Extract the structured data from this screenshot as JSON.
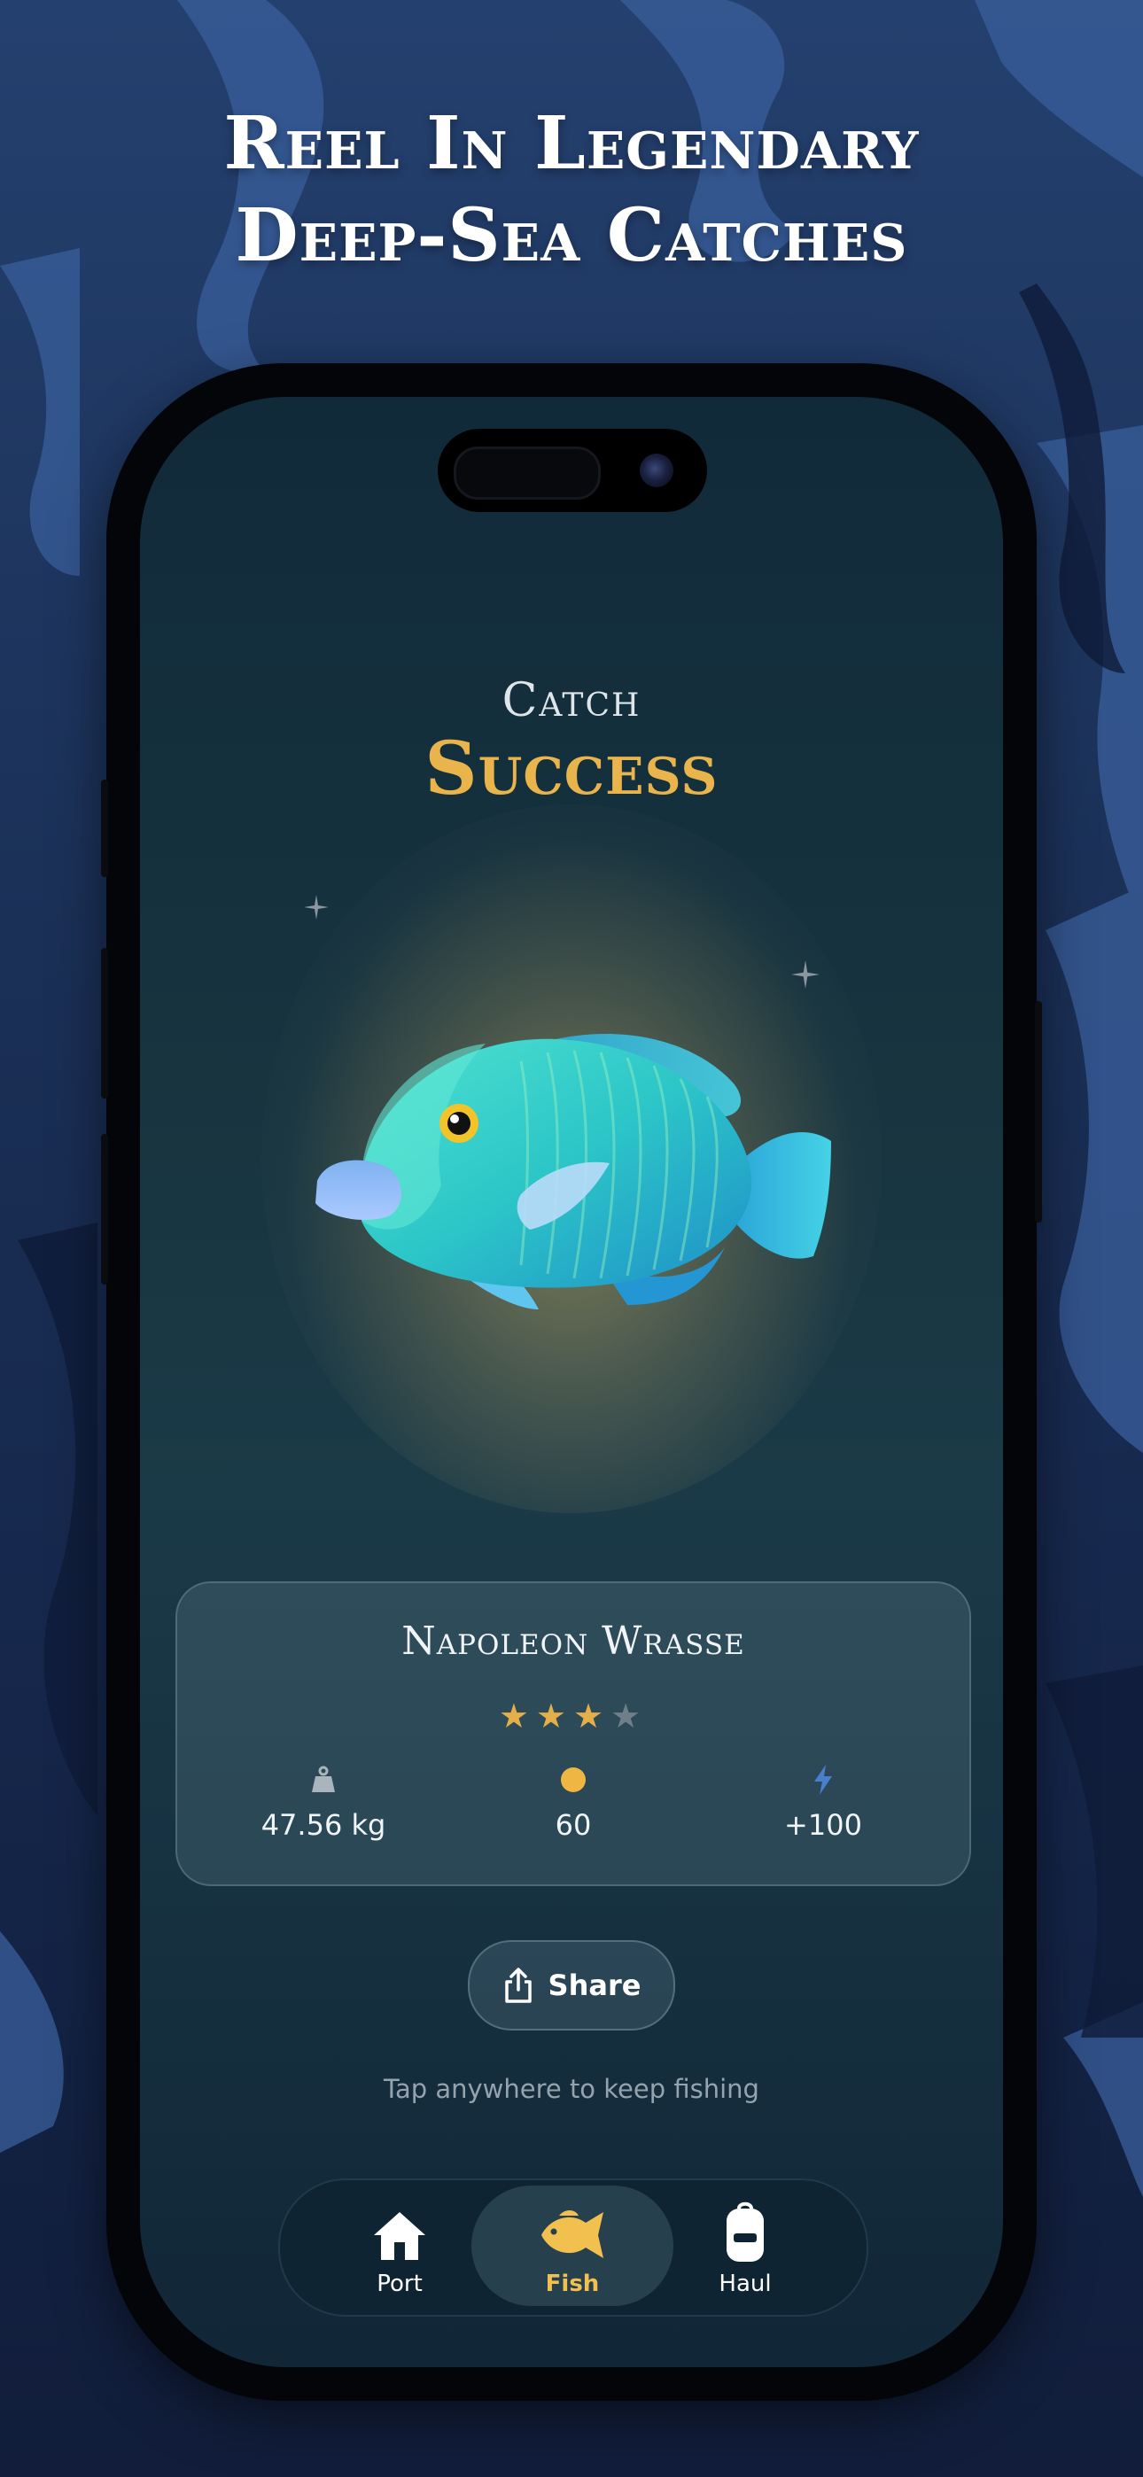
{
  "headline": {
    "line1": "Reel In Legendary",
    "line2": "Deep-Sea Catches"
  },
  "screen": {
    "title_small": "Catch",
    "title_big": "Success"
  },
  "catch_card": {
    "fish_name": "Napoleon Wrasse",
    "rating": 3,
    "rating_max": 5,
    "stats": [
      {
        "icon": "weight-icon",
        "value": "47.56 kg"
      },
      {
        "icon": "coin-icon",
        "value": "60"
      },
      {
        "icon": "lightning-icon",
        "value": "+100"
      }
    ]
  },
  "share_button": {
    "label": "Share",
    "icon": "share-icon"
  },
  "hint": "Tap anywhere to keep fishing",
  "tabbar": {
    "tabs": [
      {
        "label": "Port",
        "icon": "house-icon",
        "active": false
      },
      {
        "label": "Fish",
        "icon": "fish-icon",
        "active": true
      },
      {
        "label": "Haul",
        "icon": "backpack-icon",
        "active": false
      }
    ]
  },
  "colors": {
    "accent_gold": "#e9b44c",
    "active_tab_label": "#f2c04e",
    "star_filled": "#e4ae48",
    "star_empty": "#6f7f8a",
    "lightning": "#4a7fd0"
  }
}
